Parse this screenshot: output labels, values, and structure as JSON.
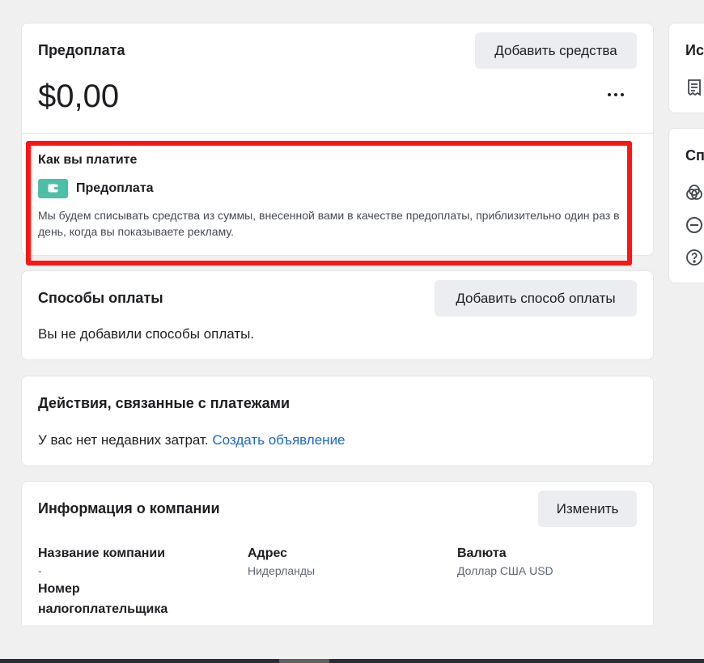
{
  "prepay": {
    "title": "Предоплата",
    "add_funds_label": "Добавить средства",
    "balance": "$0,00",
    "how_title": "Как вы платите",
    "method_name": "Предоплата",
    "method_description": "Мы будем списывать средства из суммы, внесенной вами в качестве предоплаты, приблизительно один раз в день, когда вы показываете рекламу."
  },
  "payment_methods": {
    "title": "Способы оплаты",
    "add_method_label": "Добавить способ оплаты",
    "empty_text": "Вы не добавили способы оплаты."
  },
  "activity": {
    "title": "Действия, связанные с платежами",
    "empty_text": "У вас нет недавних затрат.",
    "link_text": "Создать объявление"
  },
  "company": {
    "title": "Информация о компании",
    "edit_label": "Изменить",
    "name_label": "Название компании",
    "name_value": "-",
    "tax_label": "Номер налогоплательщика",
    "address_label": "Адрес",
    "address_value": "Нидерланды",
    "currency_label": "Валюта",
    "currency_value": "Доллар США USD"
  },
  "side": {
    "card1_title": "Ис",
    "card2_title": "Сп"
  },
  "colors": {
    "accent_link": "#1a66c9",
    "wallet_badge": "#4cbfa6",
    "highlight": "#ff1414"
  }
}
